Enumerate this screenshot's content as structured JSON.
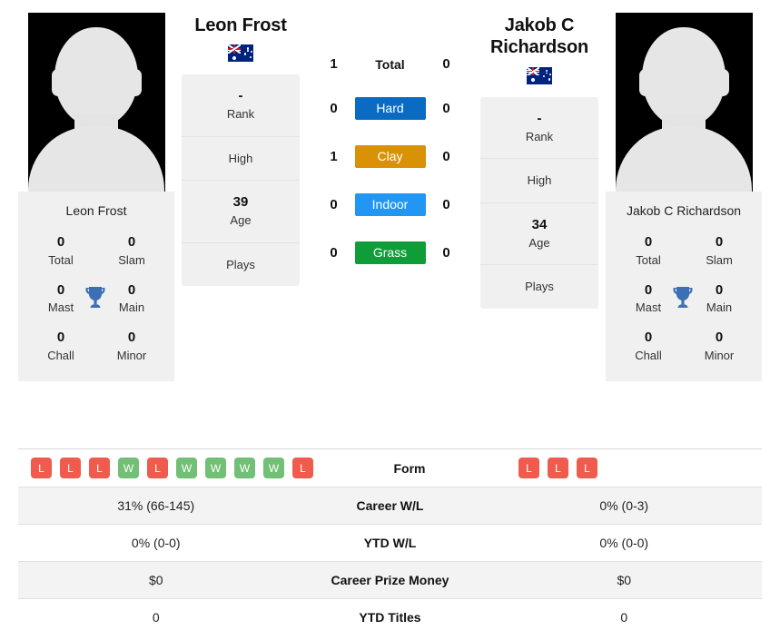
{
  "players": {
    "left": {
      "name": "Leon Frost",
      "photo_caption": "Leon Frost",
      "flag": "australia-flag",
      "titles": {
        "total": "0",
        "total_label": "Total",
        "slam": "0",
        "slam_label": "Slam",
        "mast": "0",
        "mast_label": "Mast",
        "main": "0",
        "main_label": "Main",
        "chall": "0",
        "chall_label": "Chall",
        "minor": "0",
        "minor_label": "Minor",
        "trophy_icon": "trophy-icon"
      },
      "info": {
        "rank_value": "-",
        "rank_label": "Rank",
        "high_value": "",
        "high_label": "High",
        "age_value": "39",
        "age_label": "Age",
        "plays_value": "",
        "plays_label": "Plays"
      },
      "surface_wins": {
        "total": "1",
        "hard": "0",
        "clay": "1",
        "indoor": "0",
        "grass": "0"
      },
      "form": [
        "L",
        "L",
        "L",
        "W",
        "L",
        "W",
        "W",
        "W",
        "W",
        "L"
      ],
      "stats": {
        "career_wl": "31% (66-145)",
        "ytd_wl": "0% (0-0)",
        "career_prize": "$0",
        "ytd_titles": "0"
      }
    },
    "right": {
      "name": "Jakob C Richardson",
      "photo_caption": "Jakob C Richardson",
      "flag": "australia-flag",
      "titles": {
        "total": "0",
        "total_label": "Total",
        "slam": "0",
        "slam_label": "Slam",
        "mast": "0",
        "mast_label": "Mast",
        "main": "0",
        "main_label": "Main",
        "chall": "0",
        "chall_label": "Chall",
        "minor": "0",
        "minor_label": "Minor",
        "trophy_icon": "trophy-icon"
      },
      "info": {
        "rank_value": "-",
        "rank_label": "Rank",
        "high_value": "",
        "high_label": "High",
        "age_value": "34",
        "age_label": "Age",
        "plays_value": "",
        "plays_label": "Plays"
      },
      "surface_wins": {
        "total": "0",
        "hard": "0",
        "clay": "0",
        "indoor": "0",
        "grass": "0"
      },
      "form": [
        "L",
        "L",
        "L"
      ],
      "stats": {
        "career_wl": "0% (0-3)",
        "ytd_wl": "0% (0-0)",
        "career_prize": "$0",
        "ytd_titles": "0"
      }
    }
  },
  "surfaces": [
    {
      "key": "total",
      "label": "Total",
      "color": "transparent"
    },
    {
      "key": "hard",
      "label": "Hard",
      "color": "#0b6bc2"
    },
    {
      "key": "clay",
      "label": "Clay",
      "color": "#d99206"
    },
    {
      "key": "indoor",
      "label": "Indoor",
      "color": "#2196f3"
    },
    {
      "key": "grass",
      "label": "Grass",
      "color": "#0f9d3a"
    }
  ],
  "table_labels": {
    "form": "Form",
    "career_wl": "Career W/L",
    "ytd_wl": "YTD W/L",
    "career_prize": "Career Prize Money",
    "ytd_titles": "YTD Titles"
  },
  "colors": {
    "win_badge": "#72bf76",
    "loss_badge": "#ef5b4c",
    "panel_bg": "#f0f0f0",
    "alt_row_bg": "#f3f3f3",
    "trophy": "#3d6fb4"
  }
}
